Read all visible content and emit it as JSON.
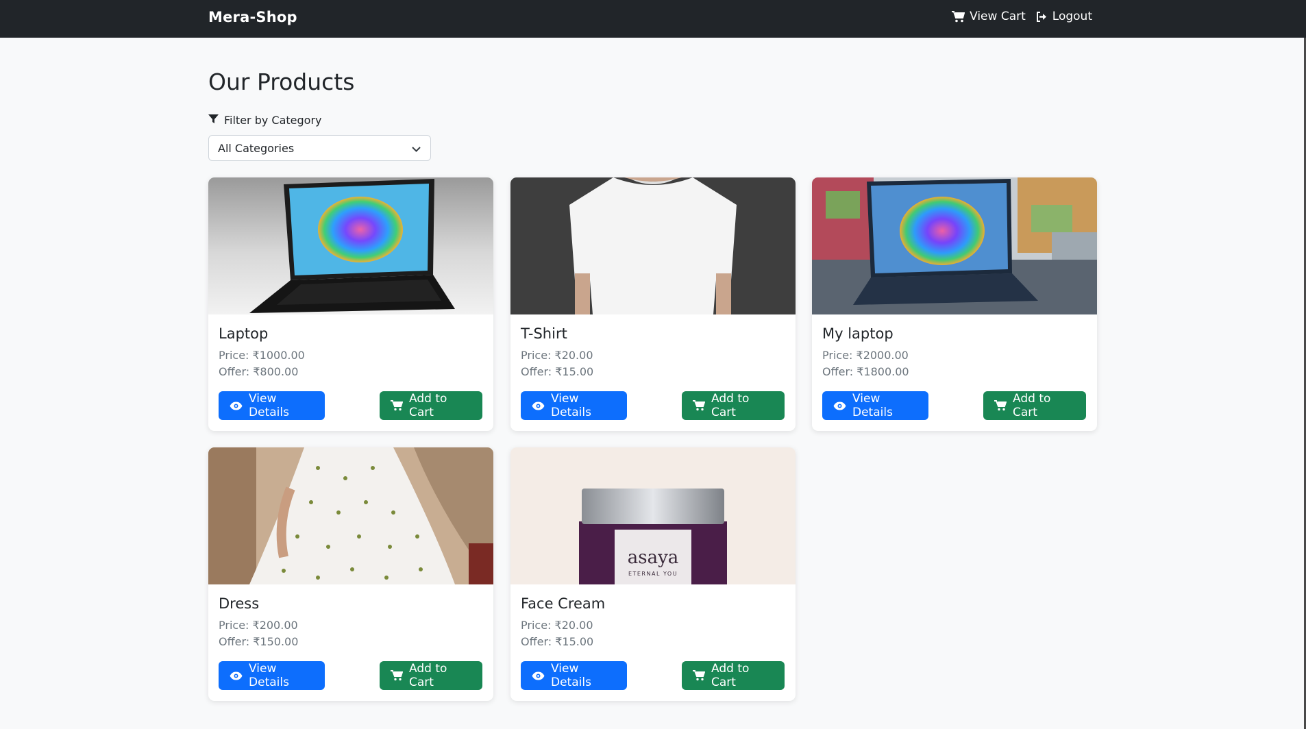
{
  "navbar": {
    "brand": "Mera-Shop",
    "view_cart_label": "View Cart",
    "logout_label": "Logout",
    "background": "#212529"
  },
  "page": {
    "title": "Our Products",
    "filter_label": "Filter by Category",
    "category_select": "All Categories"
  },
  "colors": {
    "primary": "#0d6efd",
    "success": "#198754",
    "muted": "#6c757d"
  },
  "products": [
    {
      "name": "Laptop",
      "price": "Price: ₹1000.00",
      "offer": "Offer: ₹800.00",
      "image": "laptop-image",
      "view_label": "View Details",
      "cart_label": "Add to Cart"
    },
    {
      "name": "T-Shirt",
      "price": "Price: ₹20.00",
      "offer": "Offer: ₹15.00",
      "image": "tshirt-image",
      "view_label": "View Details",
      "cart_label": "Add to Cart"
    },
    {
      "name": "My laptop",
      "price": "Price: ₹2000.00",
      "offer": "Offer: ₹1800.00",
      "image": "laptop-outdoor-image",
      "view_label": "View Details",
      "cart_label": "Add to Cart"
    },
    {
      "name": "Dress",
      "price": "Price: ₹200.00",
      "offer": "Offer: ₹150.00",
      "image": "dress-image",
      "view_label": "View Details",
      "cart_label": "Add to Cart"
    },
    {
      "name": "Face Cream",
      "price": "Price: ₹20.00",
      "offer": "Offer: ₹15.00",
      "image": "face-cream-image",
      "view_label": "View Details",
      "cart_label": "Add to Cart",
      "jar_brand": "asaya",
      "jar_tagline": "ETERNAL YOU"
    }
  ]
}
